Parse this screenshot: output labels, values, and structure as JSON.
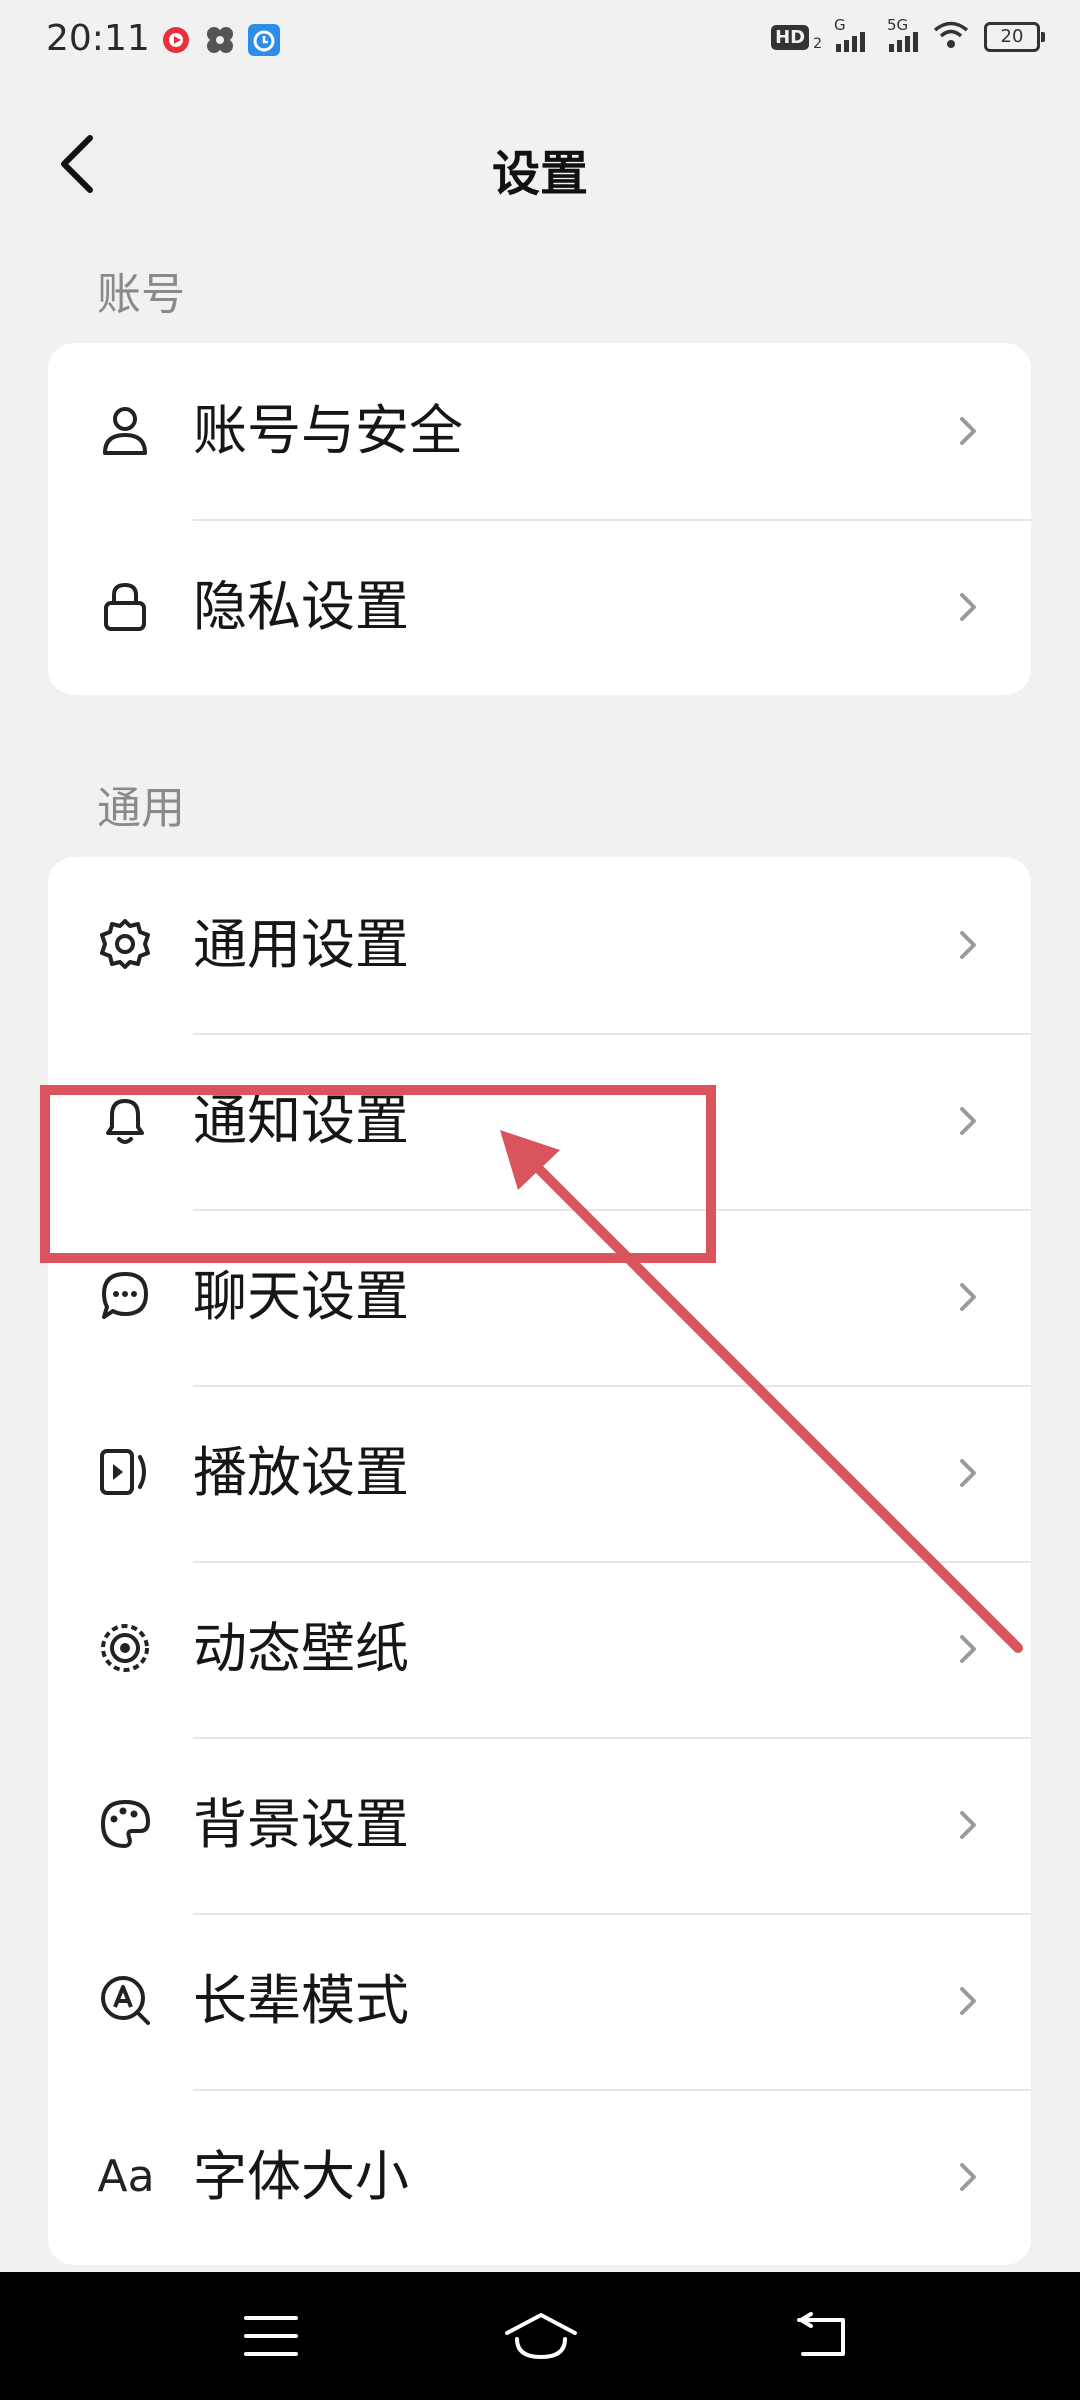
{
  "status_bar": {
    "time": "20:11",
    "hd_label": "HD",
    "hd_sub": "2",
    "sim1_label": "G",
    "sim2_label": "5G",
    "battery": "20"
  },
  "header": {
    "title": "设置",
    "back_icon": "chevron-left-icon"
  },
  "sections": [
    {
      "label": "账号",
      "items": [
        {
          "label": "账号与安全",
          "icon": "person-icon"
        },
        {
          "label": "隐私设置",
          "icon": "lock-icon"
        }
      ]
    },
    {
      "label": "通用",
      "items": [
        {
          "label": "通用设置",
          "icon": "gear-icon"
        },
        {
          "label": "通知设置",
          "icon": "bell-icon"
        },
        {
          "label": "聊天设置",
          "icon": "chat-bubble-icon"
        },
        {
          "label": "播放设置",
          "icon": "play-icon"
        },
        {
          "label": "动态壁纸",
          "icon": "dynamic-wallpaper-icon"
        },
        {
          "label": "背景设置",
          "icon": "palette-icon"
        },
        {
          "label": "长辈模式",
          "icon": "elder-mode-icon"
        },
        {
          "label": "字体大小",
          "icon": "font-size-icon",
          "icon_text": "Aa"
        }
      ]
    }
  ],
  "colors": {
    "annotation": "#d9545c",
    "background": "#f1f1f1",
    "card": "#ffffff"
  },
  "nav_bar": {
    "icons": [
      "menu-icon",
      "home-icon",
      "back-icon"
    ]
  }
}
